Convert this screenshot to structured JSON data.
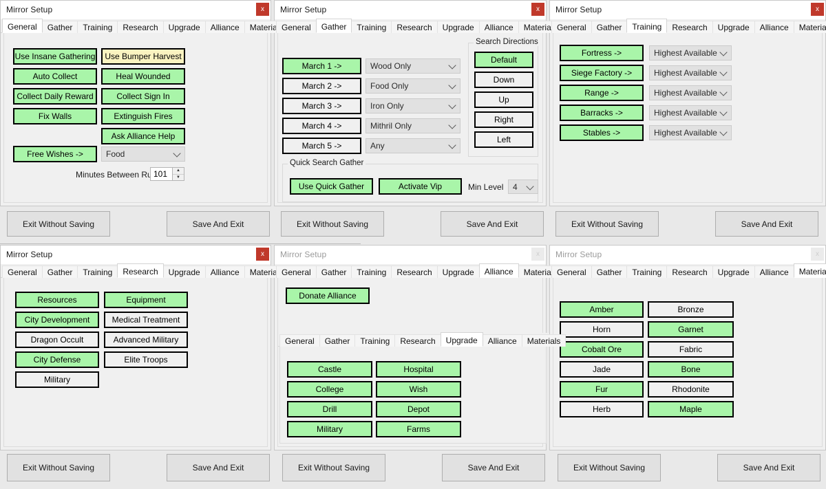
{
  "window_title": "Mirror Setup",
  "close_label": "x",
  "tabs": [
    "General",
    "Gather",
    "Training",
    "Research",
    "Upgrade",
    "Alliance",
    "Materials"
  ],
  "actions": {
    "exit": "Exit Without Saving",
    "save": "Save And Exit"
  },
  "panels": {
    "general": {
      "active_tab": "General",
      "buttons_left": [
        {
          "label": "Use Insane Gathering",
          "state": "on"
        },
        {
          "label": "Auto Collect",
          "state": "on"
        },
        {
          "label": "Collect Daily Reward",
          "state": "on"
        },
        {
          "label": "Fix Walls",
          "state": "on"
        }
      ],
      "buttons_right": [
        {
          "label": "Use Bumper Harvest",
          "state": "warn"
        },
        {
          "label": "Heal Wounded",
          "state": "on"
        },
        {
          "label": "Collect Sign In",
          "state": "on"
        },
        {
          "label": "Extinguish Fires",
          "state": "on"
        },
        {
          "label": "Ask Alliance Help",
          "state": "on"
        }
      ],
      "free_wishes": {
        "label": "Free Wishes ->",
        "state": "on"
      },
      "free_wishes_value": "Food",
      "minutes_label": "Minutes Between Runs",
      "minutes_value": "101"
    },
    "gather": {
      "active_tab": "Gather",
      "marches": [
        {
          "label": "March 1 ->",
          "state": "on",
          "resource": "Wood Only"
        },
        {
          "label": "March 2 ->",
          "state": "off",
          "resource": "Food Only"
        },
        {
          "label": "March 3 ->",
          "state": "off",
          "resource": "Iron Only"
        },
        {
          "label": "March 4 ->",
          "state": "off",
          "resource": "Mithril Only"
        },
        {
          "label": "March 5 ->",
          "state": "off",
          "resource": "Any"
        }
      ],
      "search_directions": {
        "title": "Search Directions",
        "items": [
          {
            "label": "Default",
            "state": "on"
          },
          {
            "label": "Down",
            "state": "off"
          },
          {
            "label": "Up",
            "state": "off"
          },
          {
            "label": "Right",
            "state": "off"
          },
          {
            "label": "Left",
            "state": "off"
          }
        ]
      },
      "quick": {
        "title": "Quick Search Gather",
        "use_quick_gather": {
          "label": "Use Quick Gather",
          "state": "on"
        },
        "activate_vip": {
          "label": "Activate Vip",
          "state": "on"
        },
        "min_level_label": "Min Level",
        "min_level_value": "4"
      }
    },
    "training": {
      "active_tab": "Training",
      "rows": [
        {
          "label": "Fortress ->",
          "state": "on",
          "level": "Highest Available"
        },
        {
          "label": "Siege Factory ->",
          "state": "on",
          "level": "Highest Available"
        },
        {
          "label": "Range ->",
          "state": "on",
          "level": "Highest Available"
        },
        {
          "label": "Barracks ->",
          "state": "on",
          "level": "Highest Available"
        },
        {
          "label": "Stables ->",
          "state": "on",
          "level": "Highest Available"
        }
      ]
    },
    "research": {
      "active_tab": "Research",
      "buttons_left": [
        {
          "label": "Resources",
          "state": "on"
        },
        {
          "label": "City Development",
          "state": "on"
        },
        {
          "label": "Dragon Occult",
          "state": "off"
        },
        {
          "label": "City Defense",
          "state": "on"
        },
        {
          "label": "Military",
          "state": "off"
        }
      ],
      "buttons_right": [
        {
          "label": "Equipment",
          "state": "on"
        },
        {
          "label": "Medical Treatment",
          "state": "off"
        },
        {
          "label": "Advanced Military",
          "state": "off"
        },
        {
          "label": "Elite Troops",
          "state": "off"
        }
      ]
    },
    "alliance": {
      "active_tab": "Alliance",
      "donate": {
        "label": "Donate Alliance",
        "state": "on"
      },
      "inner": {
        "active_tab": "Upgrade",
        "buttons_left": [
          {
            "label": "Castle",
            "state": "on"
          },
          {
            "label": "College",
            "state": "on"
          },
          {
            "label": "Drill",
            "state": "on"
          },
          {
            "label": "Military",
            "state": "on"
          }
        ],
        "buttons_right": [
          {
            "label": "Hospital",
            "state": "on"
          },
          {
            "label": "Wish",
            "state": "on"
          },
          {
            "label": "Depot",
            "state": "on"
          },
          {
            "label": "Farms",
            "state": "on"
          }
        ]
      }
    },
    "materials": {
      "active_tab": "Materials",
      "buttons_left": [
        {
          "label": "Amber",
          "state": "on"
        },
        {
          "label": "Horn",
          "state": "off"
        },
        {
          "label": "Cobalt Ore",
          "state": "on"
        },
        {
          "label": "Jade",
          "state": "off"
        },
        {
          "label": "Fur",
          "state": "on"
        },
        {
          "label": "Herb",
          "state": "off"
        }
      ],
      "buttons_right": [
        {
          "label": "Bronze",
          "state": "off"
        },
        {
          "label": "Garnet",
          "state": "on"
        },
        {
          "label": "Fabric",
          "state": "off"
        },
        {
          "label": "Bone",
          "state": "on"
        },
        {
          "label": "Rhodonite",
          "state": "off"
        },
        {
          "label": "Maple",
          "state": "on"
        }
      ]
    }
  },
  "colors": {
    "enabled_green": "#a9f5a9",
    "warn_yellow": "#faf3c0",
    "close_red": "#c0392b",
    "panel_bg": "#f0f0f0"
  }
}
